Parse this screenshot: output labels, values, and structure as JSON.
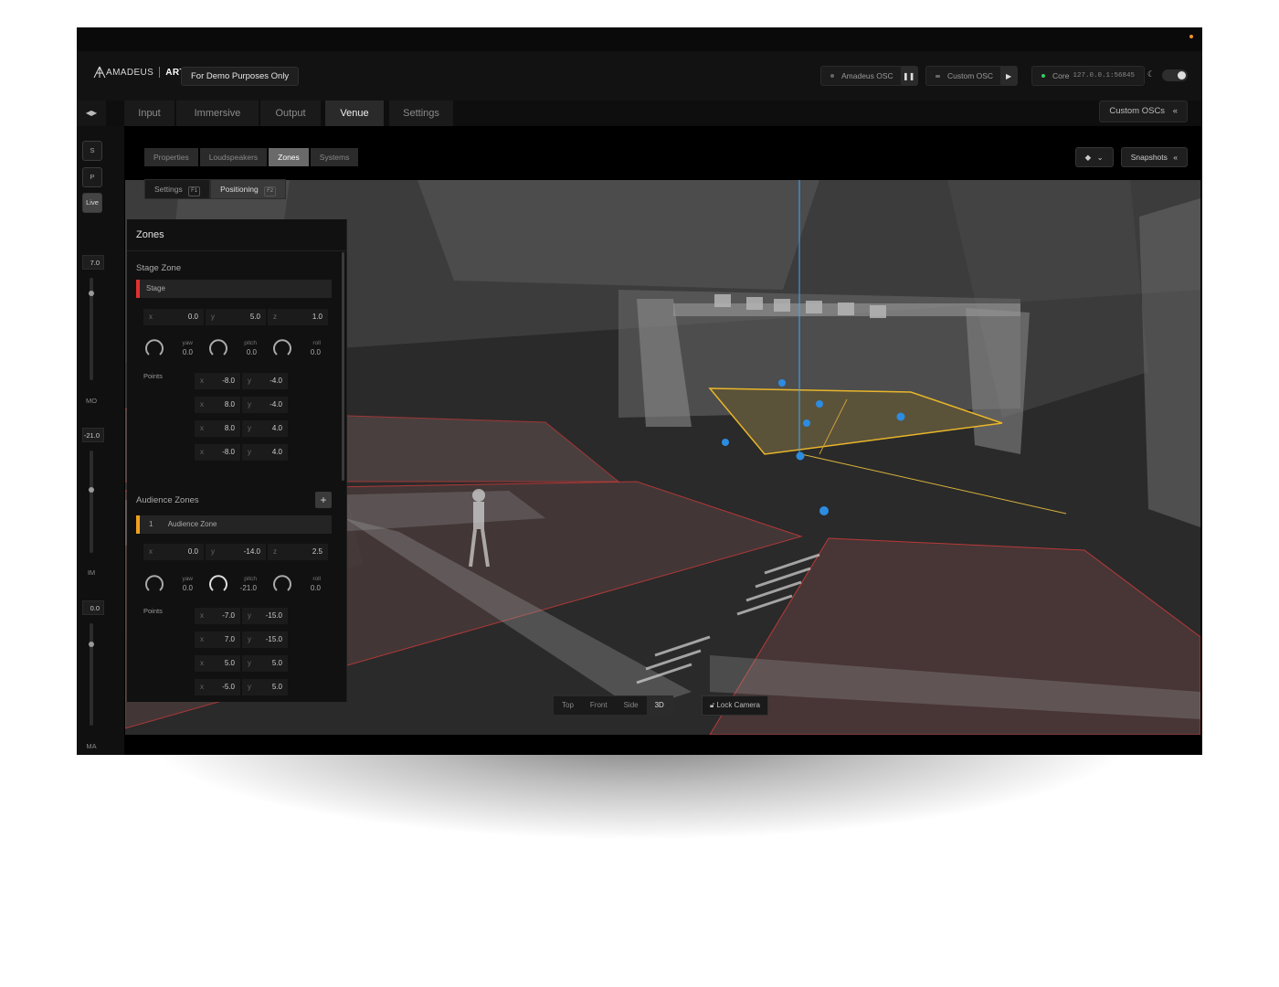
{
  "app": {
    "logo_text": "AMADEUS",
    "logo_suffix": "ART",
    "demo_label": "For Demo Purposes Only"
  },
  "connections": {
    "amadeus_osc": "Amadeus OSC",
    "custom_osc": "Custom OSC",
    "core_label": "Core",
    "core_address": "127.0.0.1:56845"
  },
  "tabs": [
    "Input",
    "Immersive",
    "Output",
    "Venue",
    "Settings"
  ],
  "active_tab": "Venue",
  "custom_oscs_button": "Custom OSCs",
  "subtabs": [
    "Properties",
    "Loudspeakers",
    "Zones",
    "Systems"
  ],
  "active_subtab": "Zones",
  "positioning_tabs": [
    {
      "label": "Settings",
      "key": "F1"
    },
    {
      "label": "Positioning",
      "key": "F2"
    }
  ],
  "snapshots_button": "Snapshots",
  "left_rail": {
    "buttons": [
      "S",
      "P",
      "Live"
    ],
    "values": [
      "7.0",
      "-21.0",
      "0.0"
    ],
    "labels": [
      "MO",
      "IM",
      "MA"
    ]
  },
  "panel": {
    "title": "Zones",
    "stage_section": "Stage Zone",
    "stage_zone": {
      "name": "Stage",
      "color": "#e03030",
      "x": "0.0",
      "y": "5.0",
      "z": "1.0",
      "yaw": "0.0",
      "pitch": "0.0",
      "roll": "0.0",
      "points": [
        [
          "-8.0",
          "-4.0"
        ],
        [
          "8.0",
          "-4.0"
        ],
        [
          "8.0",
          "4.0"
        ],
        [
          "-8.0",
          "4.0"
        ]
      ]
    },
    "points_label": "Points",
    "audience_section": "Audience Zones",
    "audience_zone": {
      "index": "1",
      "name": "Audience Zone",
      "color": "#f0a020",
      "x": "0.0",
      "y": "-14.0",
      "z": "2.5",
      "yaw": "0.0",
      "pitch": "-21.0",
      "roll": "0.0",
      "points": [
        [
          "-7.0",
          "-15.0"
        ],
        [
          "7.0",
          "-15.0"
        ],
        [
          "5.0",
          "5.0"
        ],
        [
          "-5.0",
          "5.0"
        ]
      ]
    },
    "labels": {
      "x": "x",
      "y": "y",
      "z": "z",
      "yaw": "yaw",
      "pitch": "pitch",
      "roll": "roll"
    }
  },
  "view_buttons": [
    "Top",
    "Front",
    "Side",
    "3D"
  ],
  "active_view": "3D",
  "lock_camera": "Lock Camera"
}
